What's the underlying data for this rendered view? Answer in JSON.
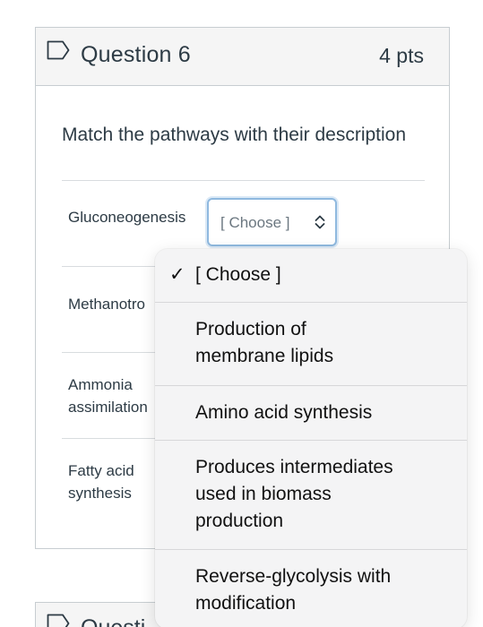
{
  "question": {
    "title": "Question 6",
    "points": "4 pts",
    "prompt": "Match the pathways with their description",
    "matches": [
      {
        "label": "Gluconeogenesis"
      },
      {
        "label": "Methanotro"
      },
      {
        "label": "Ammonia\nassimilation"
      },
      {
        "label": "Fatty acid\nsynthesis"
      }
    ],
    "select": {
      "value": "[ Choose ]"
    }
  },
  "dropdown": {
    "options": [
      {
        "label": "[ Choose ]",
        "selected": true,
        "check": "✓"
      },
      {
        "label": "Production of\nmembrane lipids",
        "selected": false
      },
      {
        "label": "Amino acid synthesis",
        "selected": false
      },
      {
        "label": "Produces intermediates\nused in biomass\nproduction",
        "selected": false
      },
      {
        "label": "Reverse-glycolysis with\nmodification",
        "selected": false
      }
    ]
  },
  "next_question": {
    "title": "Questi"
  },
  "colors": {
    "text": "#2d3b45",
    "border": "#c7cdd1",
    "header_bg": "#f5f5f5",
    "select_focus": "#8fb9df",
    "popup_bg": "#f4f4f5"
  },
  "icons": {
    "question_flag": "flag-outline-icon",
    "select_chevron": "updown-chevron-icon",
    "selected_check": "checkmark-icon"
  }
}
